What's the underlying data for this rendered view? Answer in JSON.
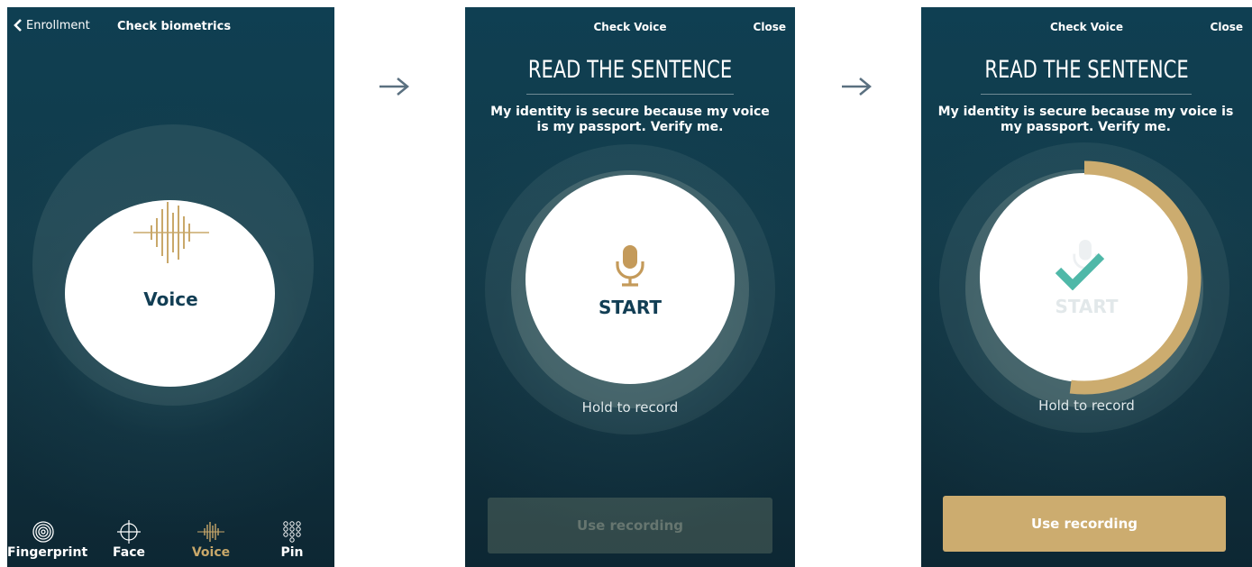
{
  "screen1": {
    "back_label": "Enrollment",
    "title": "Check biometrics",
    "method_label": "Voice",
    "tabs": [
      {
        "label": "Fingerprint",
        "icon": "fingerprint-icon"
      },
      {
        "label": "Face",
        "icon": "face-target-icon"
      },
      {
        "label": "Voice",
        "icon": "voice-wave-icon",
        "active": true
      },
      {
        "label": "Pin",
        "icon": "pin-grid-icon"
      }
    ]
  },
  "screen2": {
    "header_title": "Check Voice",
    "close_label": "Close",
    "heading": "READ THE SENTENCE",
    "sentence": "My identity is secure because my voice is my passport. Verify me.",
    "start_label": "START",
    "hold_label": "Hold to record",
    "use_button_label": "Use recording",
    "use_button_enabled": false
  },
  "screen3": {
    "header_title": "Check Voice",
    "close_label": "Close",
    "heading": "READ THE SENTENCE",
    "sentence": "My identity is secure because my voice is my passport. Verify me.",
    "start_label": "START",
    "hold_label": "Hold to record",
    "use_button_label": "Use recording",
    "use_button_enabled": true,
    "recording_progress": 0.52
  },
  "colors": {
    "accent_gold": "#ccac6f",
    "navy_text": "#123e54",
    "check_teal": "#4fb8a8",
    "background_dark": "#10303d"
  }
}
